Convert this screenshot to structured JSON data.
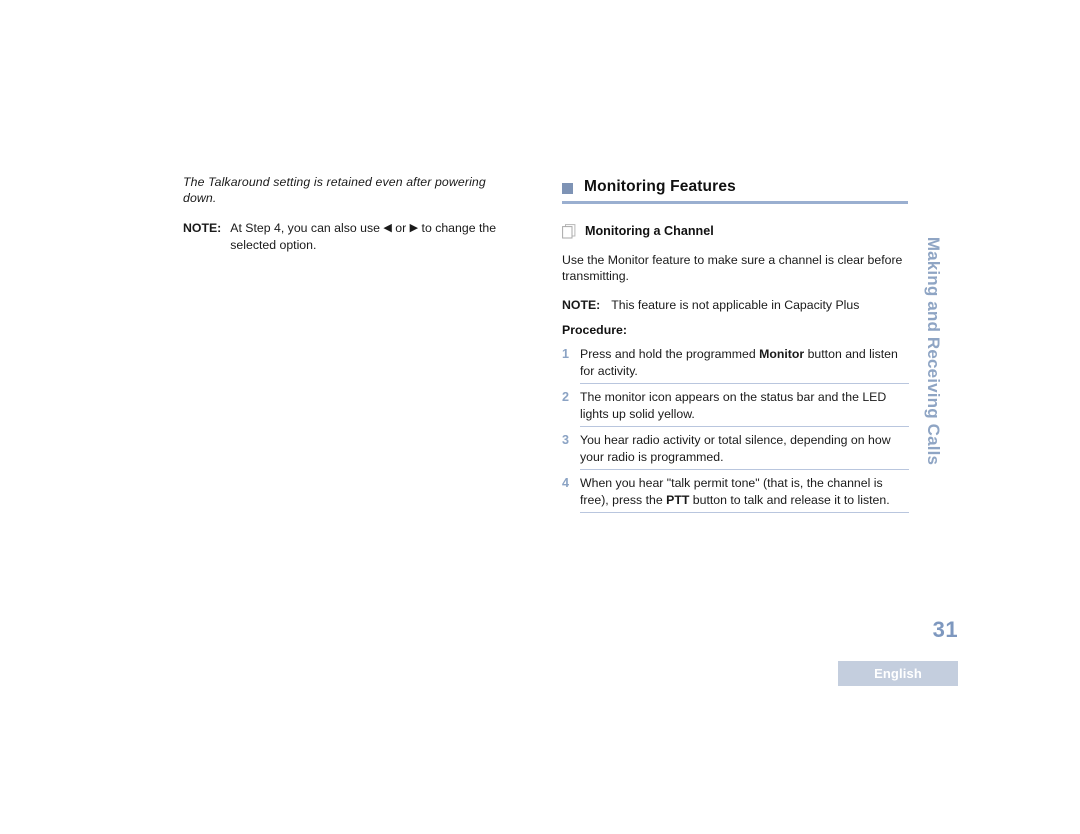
{
  "left_column": {
    "italic_note": "The Talkaround setting is retained even after powering down.",
    "note": {
      "label": "NOTE:",
      "text_before_icons": "At Step 4, you can also use ",
      "left_arrow_icon": "◀",
      "between_icons": " or ",
      "right_arrow_icon": "▶",
      "text_after_icons": " to change the selected option."
    }
  },
  "right_column": {
    "section": {
      "bullet_icon": "square-bullet",
      "title": "Monitoring Features"
    },
    "subsection": {
      "icon": "stacked-pages-icon",
      "title": "Monitoring a Channel"
    },
    "intro_paragraph": "Use the Monitor feature to make sure a channel is clear before transmitting.",
    "note": {
      "label": "NOTE:",
      "text": "This feature is not applicable in Capacity Plus"
    },
    "procedure_label": "Procedure:",
    "steps": [
      {
        "number": "1",
        "part1": "Press and hold the programmed ",
        "bold": "Monitor",
        "part2": " button and listen for activity."
      },
      {
        "number": "2",
        "part1": "The monitor icon appears on the status bar and the LED lights up solid yellow.",
        "bold": "",
        "part2": ""
      },
      {
        "number": "3",
        "part1": "You hear radio activity or total silence, depending on how your radio is programmed.",
        "bold": "",
        "part2": ""
      },
      {
        "number": "4",
        "part1": "When you hear \"talk permit tone\" (that is, the channel is free), press the ",
        "bold": "PTT",
        "part2": " button to talk and release it to listen."
      }
    ]
  },
  "side_tab": {
    "running_head": "Making and Receiving Calls"
  },
  "footer": {
    "page_number": "31",
    "language": "English"
  },
  "colors": {
    "accent_blue": "#7e93b5",
    "rule_blue": "#9aafd0",
    "step_number_blue": "#8ba3c4",
    "separator_blue": "#b9c6de",
    "side_tab_blue": "#8fa5c4",
    "page_number_blue": "#7e98bf",
    "badge_background": "#c4cede"
  }
}
